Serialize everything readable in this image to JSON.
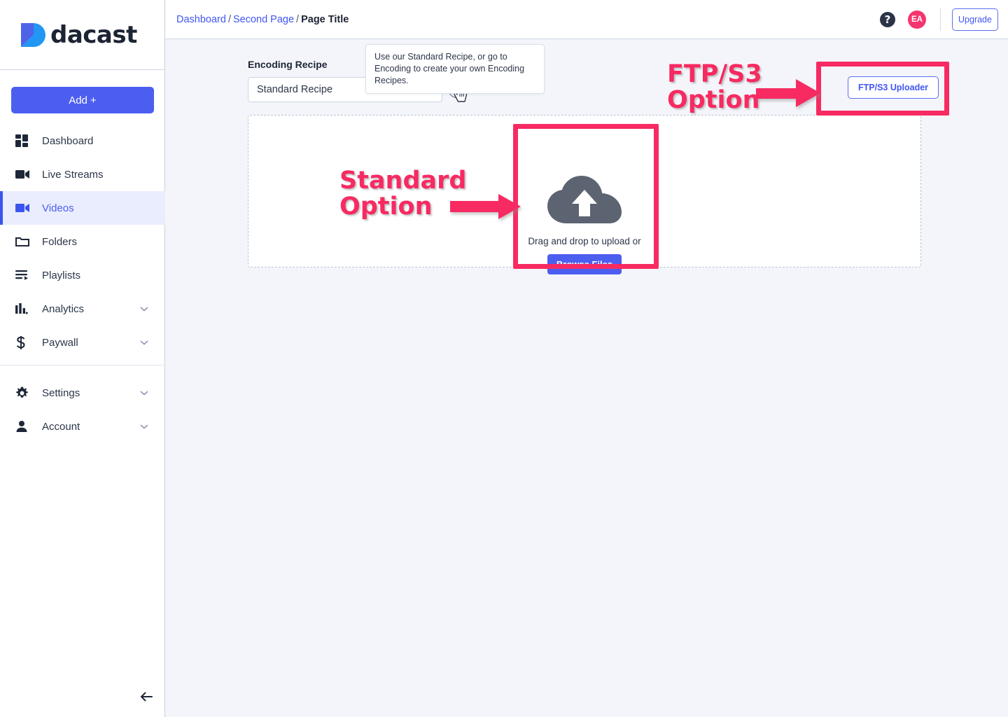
{
  "brand": {
    "name": "dacast",
    "logo_colors": [
      "#4f63e8",
      "#2196f3"
    ]
  },
  "colors": {
    "accent_blue": "#4c5ef0",
    "link_blue": "#4056f4",
    "annotation_pink": "#f72a62",
    "avatar_pink": "#f5356e",
    "page_bg": "#f4f5fa",
    "panel_white": "#ffffff"
  },
  "sidebar": {
    "add_button_label": "Add +",
    "items": [
      {
        "label": "Dashboard",
        "icon": "dashboard-grid-icon",
        "active": false,
        "expandable": false
      },
      {
        "label": "Live Streams",
        "icon": "video-camera-icon",
        "active": false,
        "expandable": false
      },
      {
        "label": "Videos",
        "icon": "video-camera-icon",
        "active": true,
        "expandable": false
      },
      {
        "label": "Folders",
        "icon": "folder-icon",
        "active": false,
        "expandable": false
      },
      {
        "label": "Playlists",
        "icon": "playlist-icon",
        "active": false,
        "expandable": false
      },
      {
        "label": "Analytics",
        "icon": "bar-chart-icon",
        "active": false,
        "expandable": true
      },
      {
        "label": "Paywall",
        "icon": "dollar-sign-icon",
        "active": false,
        "expandable": true
      }
    ],
    "bottom_items": [
      {
        "label": "Settings",
        "icon": "gear-icon",
        "active": false,
        "expandable": true
      },
      {
        "label": "Account",
        "icon": "person-icon",
        "active": false,
        "expandable": true
      }
    ],
    "collapse_icon": "arrow-left-icon"
  },
  "topbar": {
    "breadcrumb": {
      "first": "Dashboard",
      "second": "Second Page",
      "current": "Page Title",
      "separator": "/"
    },
    "help_icon_label": "?",
    "avatar_initials": "EA",
    "upgrade_label": "Upgrade"
  },
  "main": {
    "encoding_recipe_label": "Encoding Recipe",
    "recipe_selected": "Standard Recipe",
    "recipe_options": [
      "Standard Recipe"
    ],
    "info_icon_label": "i",
    "tooltip_text": "Use our Standard Recipe, or go to Encoding to create your own Encoding Recipes.",
    "drop_text": "Drag and drop to upload or",
    "browse_label": "Browse Files",
    "ftp_label": "FTP/S3 Uploader"
  },
  "annotations": [
    {
      "id": "standard",
      "line1": "Standard",
      "line2": "Option"
    },
    {
      "id": "ftp",
      "line1": "FTP/S3",
      "line2": "Option"
    }
  ]
}
